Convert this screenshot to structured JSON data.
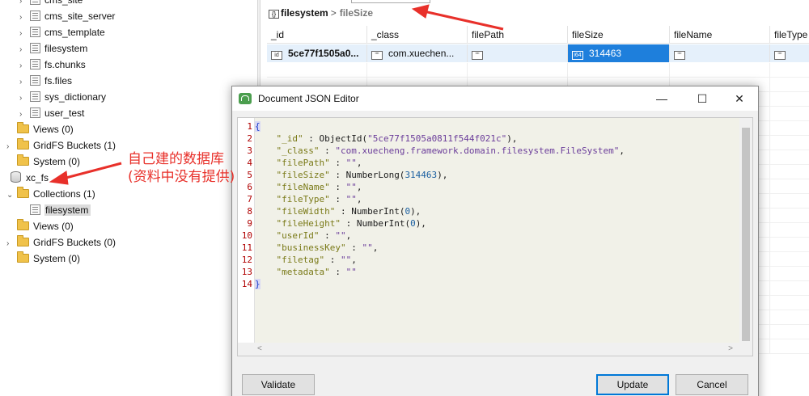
{
  "tree": {
    "items": [
      {
        "label": "cms_site",
        "kind": "collection"
      },
      {
        "label": "cms_site_server",
        "kind": "collection"
      },
      {
        "label": "cms_template",
        "kind": "collection"
      },
      {
        "label": "filesystem",
        "kind": "collection"
      },
      {
        "label": "fs.chunks",
        "kind": "collection"
      },
      {
        "label": "fs.files",
        "kind": "collection"
      },
      {
        "label": "sys_dictionary",
        "kind": "collection"
      },
      {
        "label": "user_test",
        "kind": "collection"
      },
      {
        "label": "Views (0)",
        "kind": "folder"
      },
      {
        "label": "GridFS Buckets (1)",
        "kind": "folder"
      },
      {
        "label": "System (0)",
        "kind": "folder"
      },
      {
        "label": "xc_fs",
        "kind": "database"
      },
      {
        "label": "Collections (1)",
        "kind": "folder"
      },
      {
        "label": "filesystem",
        "kind": "collection",
        "selected": true
      },
      {
        "label": "Views (0)",
        "kind": "folder"
      },
      {
        "label": "GridFS Buckets (0)",
        "kind": "folder"
      },
      {
        "label": "System (0)",
        "kind": "folder"
      }
    ]
  },
  "annotation": {
    "line1": "自己建的数据库",
    "line2": "(资料中没有提供)",
    "color": "#e8302a"
  },
  "breadcrumb": {
    "collection": "filesystem",
    "separator": ">",
    "field": "fileSize"
  },
  "grid": {
    "columns": [
      "_id",
      "_class",
      "filePath",
      "fileSize",
      "fileName",
      "fileType"
    ],
    "row": {
      "id": "5ce77f1505a0...",
      "class": "com.xuechen...",
      "filePath": "",
      "fileSize": "314463",
      "fileName": "",
      "fileType": ""
    },
    "type_icons": {
      "id": "id",
      "text": "\"\"",
      "int64": "i64"
    },
    "selected_color": "#1e7fdc"
  },
  "dialog": {
    "title": "Document JSON Editor",
    "minimize": "—",
    "maximize": "☐",
    "close": "✕",
    "buttons": {
      "validate": "Validate",
      "update": "Update",
      "cancel": "Cancel"
    },
    "lines": [
      {
        "n": "1",
        "t": [
          {
            "c": "br hl",
            "v": "{"
          }
        ]
      },
      {
        "n": "2",
        "t": [
          {
            "c": "k",
            "v": "    \"_id\""
          },
          {
            "c": "v",
            "v": " : ObjectId("
          },
          {
            "c": "s",
            "v": "\"5ce77f1505a0811f544f021c\""
          },
          {
            "c": "v",
            "v": "),"
          }
        ]
      },
      {
        "n": "3",
        "t": [
          {
            "c": "k",
            "v": "    \"_class\""
          },
          {
            "c": "v",
            "v": " : "
          },
          {
            "c": "s",
            "v": "\"com.xuecheng.framework.domain.filesystem.FileSystem\""
          },
          {
            "c": "v",
            "v": ","
          }
        ]
      },
      {
        "n": "4",
        "t": [
          {
            "c": "k",
            "v": "    \"filePath\""
          },
          {
            "c": "v",
            "v": " : "
          },
          {
            "c": "s",
            "v": "\"\""
          },
          {
            "c": "v",
            "v": ","
          }
        ]
      },
      {
        "n": "5",
        "t": [
          {
            "c": "k",
            "v": "    \"fileSize\""
          },
          {
            "c": "v",
            "v": " : NumberLong("
          },
          {
            "c": "n",
            "v": "314463"
          },
          {
            "c": "v",
            "v": "),"
          }
        ]
      },
      {
        "n": "6",
        "t": [
          {
            "c": "k",
            "v": "    \"fileName\""
          },
          {
            "c": "v",
            "v": " : "
          },
          {
            "c": "s",
            "v": "\"\""
          },
          {
            "c": "v",
            "v": ","
          }
        ]
      },
      {
        "n": "7",
        "t": [
          {
            "c": "k",
            "v": "    \"fileType\""
          },
          {
            "c": "v",
            "v": " : "
          },
          {
            "c": "s",
            "v": "\"\""
          },
          {
            "c": "v",
            "v": ","
          }
        ]
      },
      {
        "n": "8",
        "t": [
          {
            "c": "k",
            "v": "    \"fileWidth\""
          },
          {
            "c": "v",
            "v": " : NumberInt("
          },
          {
            "c": "n",
            "v": "0"
          },
          {
            "c": "v",
            "v": "),"
          }
        ]
      },
      {
        "n": "9",
        "t": [
          {
            "c": "k",
            "v": "    \"fileHeight\""
          },
          {
            "c": "v",
            "v": " : NumberInt("
          },
          {
            "c": "n",
            "v": "0"
          },
          {
            "c": "v",
            "v": "),"
          }
        ]
      },
      {
        "n": "10",
        "t": [
          {
            "c": "k",
            "v": "    \"userId\""
          },
          {
            "c": "v",
            "v": " : "
          },
          {
            "c": "s",
            "v": "\"\""
          },
          {
            "c": "v",
            "v": ","
          }
        ]
      },
      {
        "n": "11",
        "t": [
          {
            "c": "k",
            "v": "    \"businessKey\""
          },
          {
            "c": "v",
            "v": " : "
          },
          {
            "c": "s",
            "v": "\"\""
          },
          {
            "c": "v",
            "v": ","
          }
        ]
      },
      {
        "n": "12",
        "t": [
          {
            "c": "k",
            "v": "    \"filetag\""
          },
          {
            "c": "v",
            "v": " : "
          },
          {
            "c": "s",
            "v": "\"\""
          },
          {
            "c": "v",
            "v": ","
          }
        ]
      },
      {
        "n": "13",
        "t": [
          {
            "c": "k",
            "v": "    \"metadata\""
          },
          {
            "c": "v",
            "v": " : "
          },
          {
            "c": "s",
            "v": "\"\""
          }
        ]
      },
      {
        "n": "14",
        "t": [
          {
            "c": "br hl",
            "v": "}"
          }
        ]
      }
    ]
  }
}
